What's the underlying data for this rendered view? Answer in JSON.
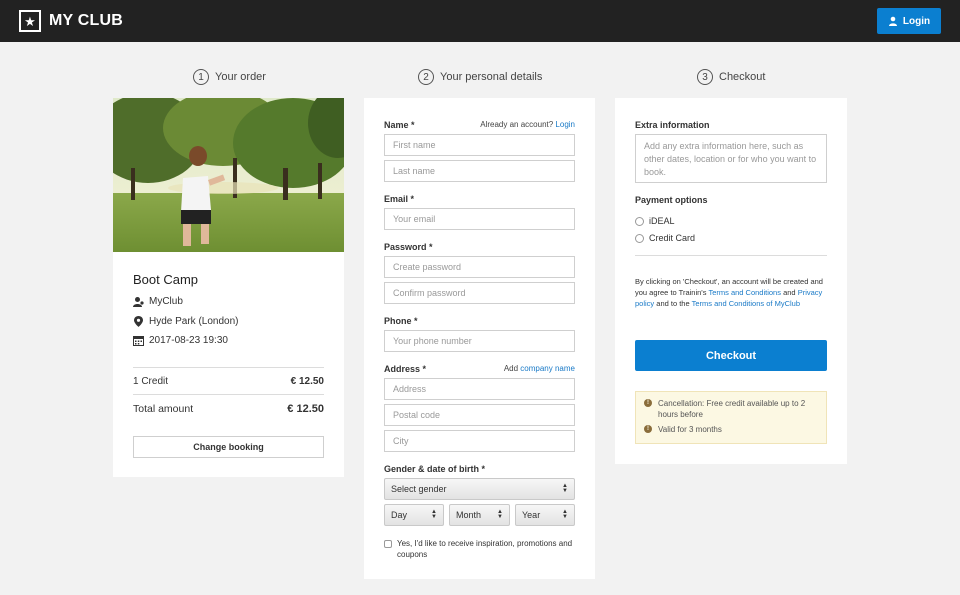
{
  "header": {
    "logo_text": "MY CLUB",
    "login_label": "Login"
  },
  "steps": [
    {
      "num": "1",
      "label": "Your order"
    },
    {
      "num": "2",
      "label": "Your personal details"
    },
    {
      "num": "3",
      "label": "Checkout"
    }
  ],
  "order": {
    "title": "Boot Camp",
    "club": "MyClub",
    "location": "Hyde Park (London)",
    "datetime": "2017-08-23 19:30",
    "credit_label": "1 Credit",
    "credit_amount": "€ 12.50",
    "total_label": "Total amount",
    "total_amount": "€ 12.50",
    "change_button": "Change booking"
  },
  "details": {
    "name_label": "Name *",
    "account_prompt": "Already an account?",
    "login_link": "Login",
    "first_name_placeholder": "First name",
    "last_name_placeholder": "Last name",
    "email_label": "Email *",
    "email_placeholder": "Your email",
    "password_label": "Password *",
    "password_placeholder": "Create password",
    "confirm_placeholder": "Confirm password",
    "phone_label": "Phone *",
    "phone_placeholder": "Your phone number",
    "address_label": "Address *",
    "add_text": "Add",
    "company_link": "company name",
    "address_placeholder": "Address",
    "postal_placeholder": "Postal code",
    "city_placeholder": "City",
    "gender_dob_label": "Gender & date of birth *",
    "gender_select": "Select gender",
    "day_select": "Day",
    "month_select": "Month",
    "year_select": "Year",
    "newsletter_text": "Yes, I'd like to receive inspiration, promotions and coupons"
  },
  "checkout": {
    "extra_label": "Extra information",
    "extra_placeholder": "Add any extra information here, such as other dates, location or for who you want to book.",
    "payment_label": "Payment options",
    "payment_options": [
      "iDEAL",
      "Credit Card"
    ],
    "terms_1": "By clicking on 'Checkout', an account will be created and you agree to Trainin's",
    "terms_link_1": "Terms and Conditions",
    "terms_2": "and",
    "terms_link_2": "Privacy policy",
    "terms_3": "and to the",
    "terms_link_3": "Terms and Conditions of MyClub",
    "checkout_button": "Checkout",
    "notes": [
      "Cancellation: Free credit available up to 2 hours before",
      "Valid for 3 months"
    ]
  },
  "colors": {
    "accent": "#0b7fd0",
    "topbar": "#222222",
    "link": "#1a7ac7",
    "notice_bg": "#fcf8e3"
  }
}
